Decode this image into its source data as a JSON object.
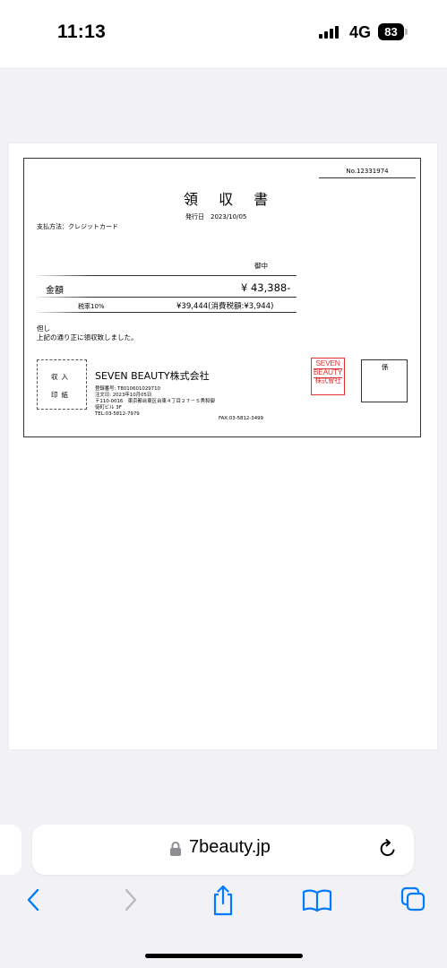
{
  "status": {
    "time": "11:13",
    "network": "4G",
    "battery": "83"
  },
  "receipt": {
    "number": "No.12331974",
    "title": "領 収 書",
    "issue_date": "発行日　2023/10/05",
    "payment_method": "支払方法：クレジットカード",
    "honorific": "御中",
    "amount_label": "金額",
    "amount_value": "¥ 43,388-",
    "tax_rate": "税率10%",
    "tax_detail": "¥39,444(消費税額:¥3,944)",
    "note_line1": "但し",
    "note_line2": "上記の通り正に領収致しました。",
    "revenue_stamp_line1": "収入",
    "revenue_stamp_line2": "印紙",
    "company_name": "SEVEN BEAUTY株式会社",
    "company_info": "登録番号: T8010601029710\n注文日: 2023年10月05日\n〒110-0016　東京都台東区台東４丁目２７－５秀和御\n徒町ビル 3F\nTEL:03-5812-7979",
    "fax": "FAX:03-5812-3499",
    "seal_text": [
      "SEVEN",
      "BEAUTY",
      "株式會社"
    ],
    "person_in_charge_label": "係"
  },
  "browser": {
    "url": "7beauty.jp"
  },
  "icons": {
    "lock": "lock-icon",
    "reload": "reload-icon",
    "back": "back-icon",
    "forward": "forward-icon",
    "share": "share-icon",
    "bookmarks": "bookmarks-icon",
    "tabs": "tabs-icon"
  },
  "colors": {
    "accent": "#007aff",
    "seal": "#d33333",
    "disabled": "#b8b8bd"
  }
}
